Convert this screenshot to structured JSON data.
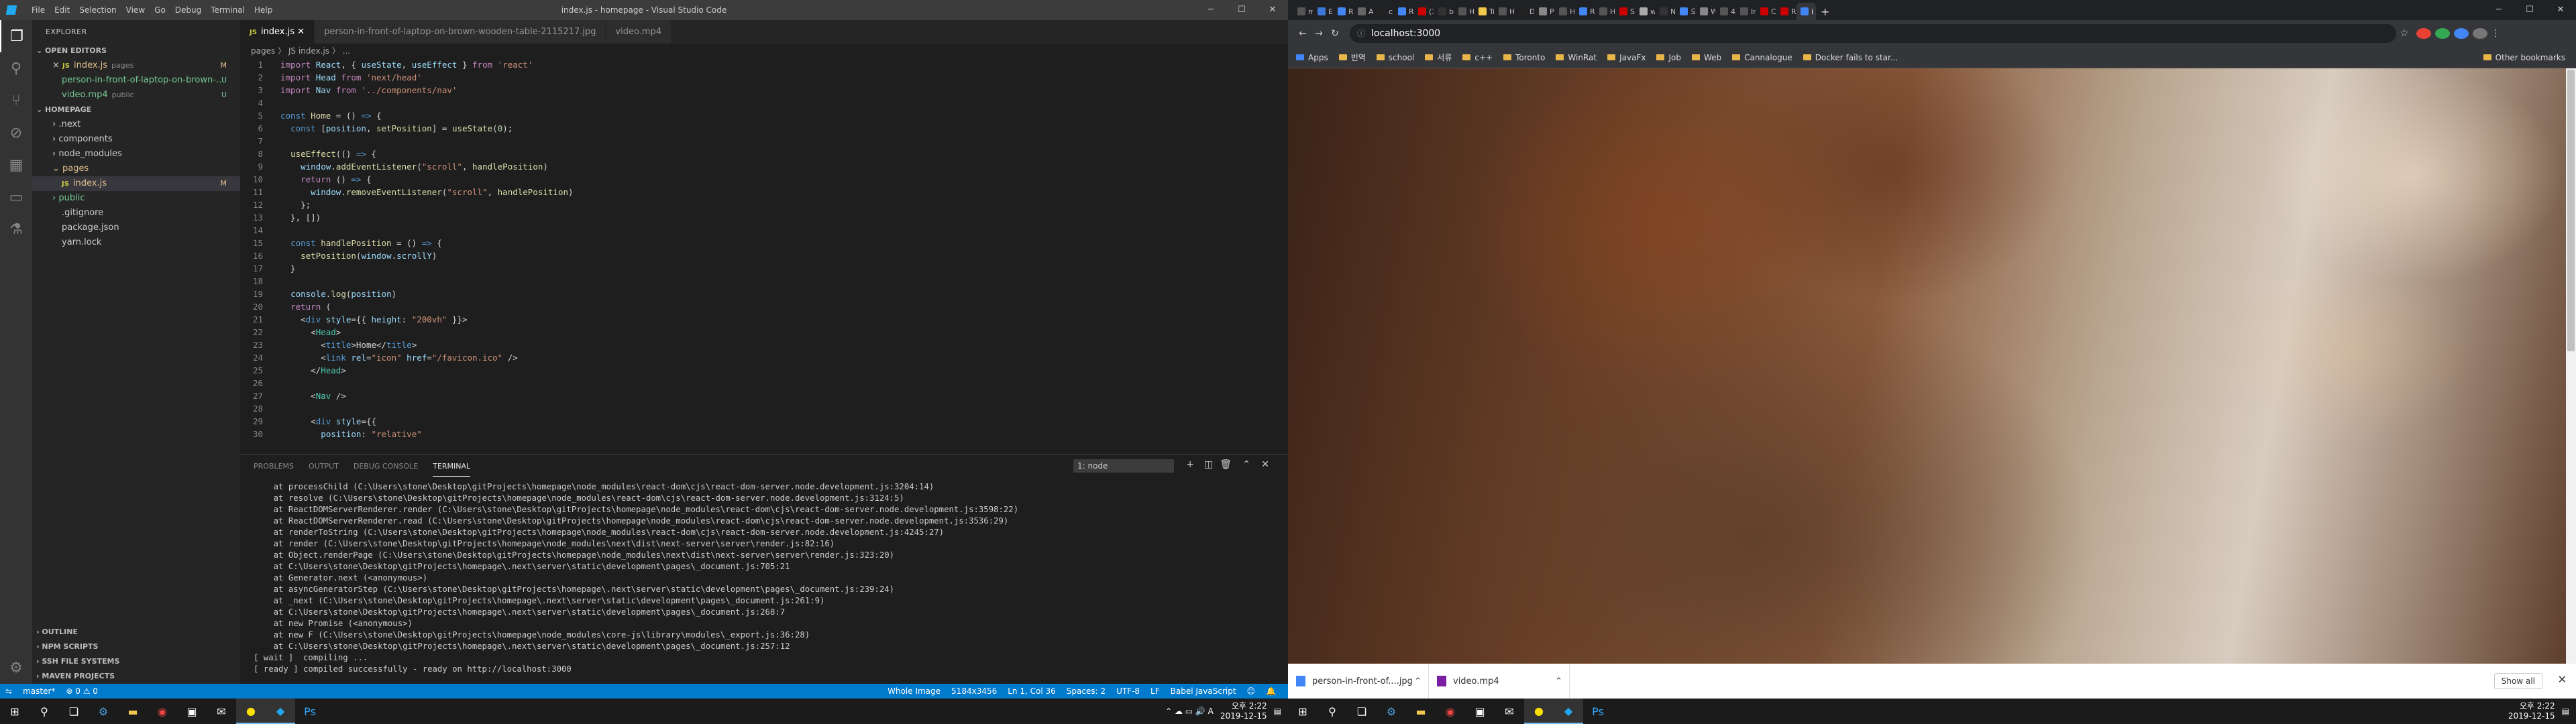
{
  "vscode": {
    "window_title": "index.js - homepage - Visual Studio Code",
    "menu": [
      "File",
      "Edit",
      "Selection",
      "View",
      "Go",
      "Debug",
      "Terminal",
      "Help"
    ],
    "explorer_title": "EXPLORER",
    "open_editors": {
      "label": "OPEN EDITORS",
      "items": [
        {
          "close": "×",
          "name": "index.js",
          "hint": "pages",
          "badge": "M"
        },
        {
          "close": "",
          "name": "person-in-front-of-laptop-on-brown-...",
          "hint": "",
          "badge": "U"
        },
        {
          "close": "",
          "name": "video.mp4",
          "hint": "public",
          "badge": "U"
        }
      ]
    },
    "workspace": {
      "label": "HOMEPAGE",
      "items": [
        {
          "name": ".next",
          "badge": ""
        },
        {
          "name": "components",
          "badge": ""
        },
        {
          "name": "node_modules",
          "badge": ""
        },
        {
          "name": "pages",
          "badge": ""
        },
        {
          "name": "index.js",
          "badge": "M"
        },
        {
          "name": "public",
          "badge": ""
        },
        {
          "name": ".gitignore",
          "badge": ""
        },
        {
          "name": "package.json",
          "badge": ""
        },
        {
          "name": "yarn.lock",
          "badge": ""
        }
      ]
    },
    "bottom_sections": [
      "OUTLINE",
      "NPM SCRIPTS",
      "SSH FILE SYSTEMS",
      "MAVEN PROJECTS"
    ],
    "tabs": [
      "index.js",
      "person-in-front-of-laptop-on-brown-wooden-table-2115217.jpg",
      "video.mp4"
    ],
    "breadcrumb": "pages 〉 JS index.js 〉 ...",
    "code": [
      [
        [
          "kw",
          "import "
        ],
        [
          "var",
          "React"
        ],
        [
          "pl",
          ", { "
        ],
        [
          "var",
          "useState"
        ],
        [
          "pl",
          ", "
        ],
        [
          "var",
          "useEffect"
        ],
        [
          "pl",
          " } "
        ],
        [
          "kw",
          "from "
        ],
        [
          "str",
          "'react'"
        ]
      ],
      [
        [
          "kw",
          "import "
        ],
        [
          "var",
          "Head "
        ],
        [
          "kw",
          "from "
        ],
        [
          "str",
          "'next/head'"
        ]
      ],
      [
        [
          "kw",
          "import "
        ],
        [
          "var",
          "Nav "
        ],
        [
          "kw",
          "from "
        ],
        [
          "str",
          "'../components/nav'"
        ]
      ],
      [],
      [
        [
          "kb",
          "const "
        ],
        [
          "fn",
          "Home"
        ],
        [
          "pl",
          " = () "
        ],
        [
          "kb",
          "=>"
        ],
        [
          "pl",
          " {"
        ]
      ],
      [
        [
          "pl",
          "  "
        ],
        [
          "kb",
          "const "
        ],
        [
          "pl",
          "["
        ],
        [
          "var",
          "position"
        ],
        [
          "pl",
          ", "
        ],
        [
          "fn",
          "setPosition"
        ],
        [
          "pl",
          "] = "
        ],
        [
          "fn",
          "useState"
        ],
        [
          "pl",
          "("
        ],
        [
          "num",
          "0"
        ],
        [
          "pl",
          ");"
        ]
      ],
      [],
      [
        [
          "pl",
          "  "
        ],
        [
          "fn",
          "useEffect"
        ],
        [
          "pl",
          "(() "
        ],
        [
          "kb",
          "=>"
        ],
        [
          "pl",
          " {"
        ]
      ],
      [
        [
          "pl",
          "    "
        ],
        [
          "var",
          "window"
        ],
        [
          "pl",
          "."
        ],
        [
          "fn",
          "addEventListener"
        ],
        [
          "pl",
          "("
        ],
        [
          "str",
          "\"scroll\""
        ],
        [
          "pl",
          ", "
        ],
        [
          "fn",
          "handlePosition"
        ],
        [
          "pl",
          ")"
        ]
      ],
      [
        [
          "pl",
          "    "
        ],
        [
          "kw",
          "return"
        ],
        [
          "pl",
          " () "
        ],
        [
          "kb",
          "=>"
        ],
        [
          "pl",
          " {"
        ]
      ],
      [
        [
          "pl",
          "      "
        ],
        [
          "var",
          "window"
        ],
        [
          "pl",
          "."
        ],
        [
          "fn",
          "removeEventListener"
        ],
        [
          "pl",
          "("
        ],
        [
          "str",
          "\"scroll\""
        ],
        [
          "pl",
          ", "
        ],
        [
          "fn",
          "handlePosition"
        ],
        [
          "pl",
          ")"
        ]
      ],
      [
        [
          "pl",
          "    };"
        ]
      ],
      [
        [
          "pl",
          "  }, [])"
        ]
      ],
      [],
      [
        [
          "pl",
          "  "
        ],
        [
          "kb",
          "const "
        ],
        [
          "fn",
          "handlePosition"
        ],
        [
          "pl",
          " = () "
        ],
        [
          "kb",
          "=>"
        ],
        [
          "pl",
          " {"
        ]
      ],
      [
        [
          "pl",
          "    "
        ],
        [
          "fn",
          "setPosition"
        ],
        [
          "pl",
          "("
        ],
        [
          "var",
          "window"
        ],
        [
          "pl",
          "."
        ],
        [
          "var",
          "scrollY"
        ],
        [
          "pl",
          ")"
        ]
      ],
      [
        [
          "pl",
          "  }"
        ]
      ],
      [],
      [
        [
          "pl",
          "  "
        ],
        [
          "var",
          "console"
        ],
        [
          "pl",
          "."
        ],
        [
          "fn",
          "log"
        ],
        [
          "pl",
          "("
        ],
        [
          "var",
          "position"
        ],
        [
          "pl",
          ")"
        ]
      ],
      [
        [
          "pl",
          "  "
        ],
        [
          "kw",
          "return"
        ],
        [
          "pl",
          " ("
        ]
      ],
      [
        [
          "pl",
          "    <"
        ],
        [
          "kb",
          "div "
        ],
        [
          "var",
          "style"
        ],
        [
          "pl",
          "={{ "
        ],
        [
          "var",
          "height"
        ],
        [
          "pl",
          ": "
        ],
        [
          "str",
          "\"200vh\""
        ],
        [
          "pl",
          " }}>"
        ]
      ],
      [
        [
          "pl",
          "      <"
        ],
        [
          "tag",
          "Head"
        ],
        [
          "pl",
          ">"
        ]
      ],
      [
        [
          "pl",
          "        <"
        ],
        [
          "kb",
          "title"
        ],
        [
          "pl",
          ">Home</"
        ],
        [
          "kb",
          "title"
        ],
        [
          "pl",
          ">"
        ]
      ],
      [
        [
          "pl",
          "        <"
        ],
        [
          "kb",
          "link "
        ],
        [
          "var",
          "rel"
        ],
        [
          "pl",
          "="
        ],
        [
          "str",
          "\"icon\" "
        ],
        [
          "var",
          "href"
        ],
        [
          "pl",
          "="
        ],
        [
          "str",
          "\"/favicon.ico\""
        ],
        [
          "pl",
          " />"
        ]
      ],
      [
        [
          "pl",
          "      </"
        ],
        [
          "tag",
          "Head"
        ],
        [
          "pl",
          ">"
        ]
      ],
      [],
      [
        [
          "pl",
          "      <"
        ],
        [
          "tag",
          "Nav"
        ],
        [
          "pl",
          " />"
        ]
      ],
      [],
      [
        [
          "pl",
          "      <"
        ],
        [
          "kb",
          "div "
        ],
        [
          "var",
          "style"
        ],
        [
          "pl",
          "={{"
        ]
      ],
      [
        [
          "pl",
          "        "
        ],
        [
          "var",
          "position"
        ],
        [
          "pl",
          ": "
        ],
        [
          "str",
          "\"relative\""
        ]
      ]
    ],
    "panel_tabs": [
      "PROBLEMS",
      "OUTPUT",
      "DEBUG CONSOLE",
      "TERMINAL"
    ],
    "terminal_select": "1: node",
    "terminal": [
      "    at processChild (C:\\Users\\stone\\Desktop\\gitProjects\\homepage\\node_modules\\react-dom\\cjs\\react-dom-server.node.development.js:3204:14)",
      "    at resolve (C:\\Users\\stone\\Desktop\\gitProjects\\homepage\\node_modules\\react-dom\\cjs\\react-dom-server.node.development.js:3124:5)",
      "    at ReactDOMServerRenderer.render (C:\\Users\\stone\\Desktop\\gitProjects\\homepage\\node_modules\\react-dom\\cjs\\react-dom-server.node.development.js:3598:22)",
      "    at ReactDOMServerRenderer.read (C:\\Users\\stone\\Desktop\\gitProjects\\homepage\\node_modules\\react-dom\\cjs\\react-dom-server.node.development.js:3536:29)",
      "    at renderToString (C:\\Users\\stone\\Desktop\\gitProjects\\homepage\\node_modules\\react-dom\\cjs\\react-dom-server.node.development.js:4245:27)",
      "    at render (C:\\Users\\stone\\Desktop\\gitProjects\\homepage\\node_modules\\next\\dist\\next-server\\server\\render.js:82:16)",
      "    at Object.renderPage (C:\\Users\\stone\\Desktop\\gitProjects\\homepage\\node_modules\\next\\dist\\next-server\\server\\render.js:323:20)",
      "    at C:\\Users\\stone\\Desktop\\gitProjects\\homepage\\.next\\server\\static\\development\\pages\\_document.js:705:21",
      "    at Generator.next (<anonymous>)",
      "    at asyncGeneratorStep (C:\\Users\\stone\\Desktop\\gitProjects\\homepage\\.next\\server\\static\\development\\pages\\_document.js:239:24)",
      "    at _next (C:\\Users\\stone\\Desktop\\gitProjects\\homepage\\.next\\server\\static\\development\\pages\\_document.js:261:9)",
      "    at C:\\Users\\stone\\Desktop\\gitProjects\\homepage\\.next\\server\\static\\development\\pages\\_document.js:268:7",
      "    at new Promise (<anonymous>)",
      "    at new F (C:\\Users\\stone\\Desktop\\gitProjects\\homepage\\node_modules\\core-js\\library\\modules\\_export.js:36:28)",
      "    at C:\\Users\\stone\\Desktop\\gitProjects\\homepage\\.next\\server\\static\\development\\pages\\_document.js:257:12",
      "[ wait ]  compiling ...",
      "[ ready ] compiled successfully - ready on http://localhost:3000"
    ],
    "status_left": [
      "master*",
      "⊗ 0 ⚠ 0"
    ],
    "status_right": [
      "Whole Image",
      "5184x3456",
      "Ln 1, Col 36",
      "Spaces: 2",
      "UTF-8",
      "LF",
      "Babel JavaScript"
    ],
    "taskbar_time": "오후 2:22",
    "taskbar_date": "2019-12-15"
  },
  "chrome": {
    "tabs": [
      "mov",
      "Edit",
      "Rea",
      "Abc",
      "che",
      "Rea",
      "(3)",
      "bac",
      "Hov",
      "Tryi",
      "Hov",
      "Doc",
      "Perr",
      "Hov",
      "Rea",
      "How",
      "Stor",
      "wea",
      "NE",
      "오리",
      "WP",
      "450",
      "Info",
      "Car",
      "RE",
      "i"
    ],
    "url": "localhost:3000",
    "bookmarks": [
      "Apps",
      "번역",
      "school",
      "서류",
      "c++",
      "Toronto",
      "WinRat",
      "JavaFx",
      "Job",
      "Web",
      "Cannalogue",
      "Docker fails to star...",
      "Other bookmarks"
    ],
    "downloads": [
      "person-in-front-of....jpg",
      "video.mp4"
    ],
    "show_all": "Show all",
    "taskbar_time": "오후 2:22",
    "taskbar_date": "2019-12-15"
  }
}
